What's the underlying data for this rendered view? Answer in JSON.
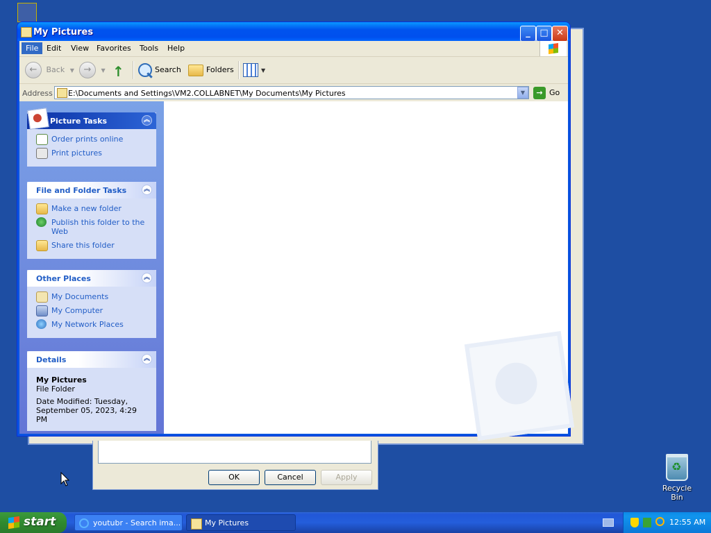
{
  "window": {
    "title": "My Pictures"
  },
  "menu": [
    "File",
    "Edit",
    "View",
    "Favorites",
    "Tools",
    "Help"
  ],
  "toolbar": {
    "back": "Back",
    "search": "Search",
    "folders": "Folders"
  },
  "address": {
    "label": "Address",
    "value": "E:\\Documents and Settings\\VM2.COLLABNET\\My Documents\\My Pictures",
    "go": "Go"
  },
  "panes": {
    "picture_tasks": {
      "title": "Picture Tasks",
      "items": [
        "Order prints online",
        "Print pictures"
      ]
    },
    "file_folder_tasks": {
      "title": "File and Folder Tasks",
      "items": [
        "Make a new folder",
        "Publish this folder to the Web",
        "Share this folder"
      ]
    },
    "other_places": {
      "title": "Other Places",
      "items": [
        "My Documents",
        "My Computer",
        "My Network Places"
      ]
    },
    "details": {
      "title": "Details",
      "name": "My Pictures",
      "type": "File Folder",
      "modified": "Date Modified: Tuesday, September 05, 2023, 4:29 PM"
    }
  },
  "background_dialog": {
    "ok": "OK",
    "cancel": "Cancel",
    "apply": "Apply"
  },
  "desktop": {
    "recycle_bin": "Recycle Bin"
  },
  "taskbar": {
    "start": "start",
    "tasks": [
      "youtubr - Search ima...",
      "My Pictures"
    ],
    "clock": "12:55 AM"
  }
}
